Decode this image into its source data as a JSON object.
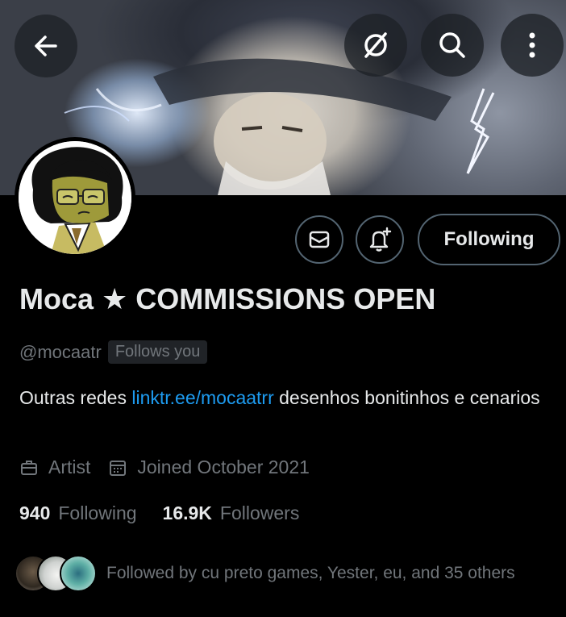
{
  "header": {
    "back_icon": "arrow-left-icon",
    "translate_icon": "slashed-circle-icon",
    "search_icon": "search-icon",
    "more_icon": "vertical-dots-icon"
  },
  "actions": {
    "message_icon": "mail-icon",
    "notify_icon": "bell-plus-icon",
    "following_label": "Following"
  },
  "profile": {
    "name": "Moca ★ COMMISSIONS OPEN",
    "handle": "@mocaatr",
    "follows_you": "Follows you",
    "bio_prefix": "Outras redes ",
    "bio_link": "linktr.ee/mocaatrr",
    "bio_suffix": " desenhos bonitinhos e cenarios",
    "category": "Artist",
    "joined": "Joined October 2021"
  },
  "stats": {
    "following_count": "940",
    "following_label": "Following",
    "followers_count": "16.9K",
    "followers_label": "Followers"
  },
  "followed_by": {
    "text": "Followed by cu preto games, Yester, eu, and 35 others"
  },
  "colors": {
    "background": "#000000",
    "text_primary": "#e7e9ea",
    "text_secondary": "#71767b",
    "link": "#1d9bf0",
    "border": "#536471"
  }
}
